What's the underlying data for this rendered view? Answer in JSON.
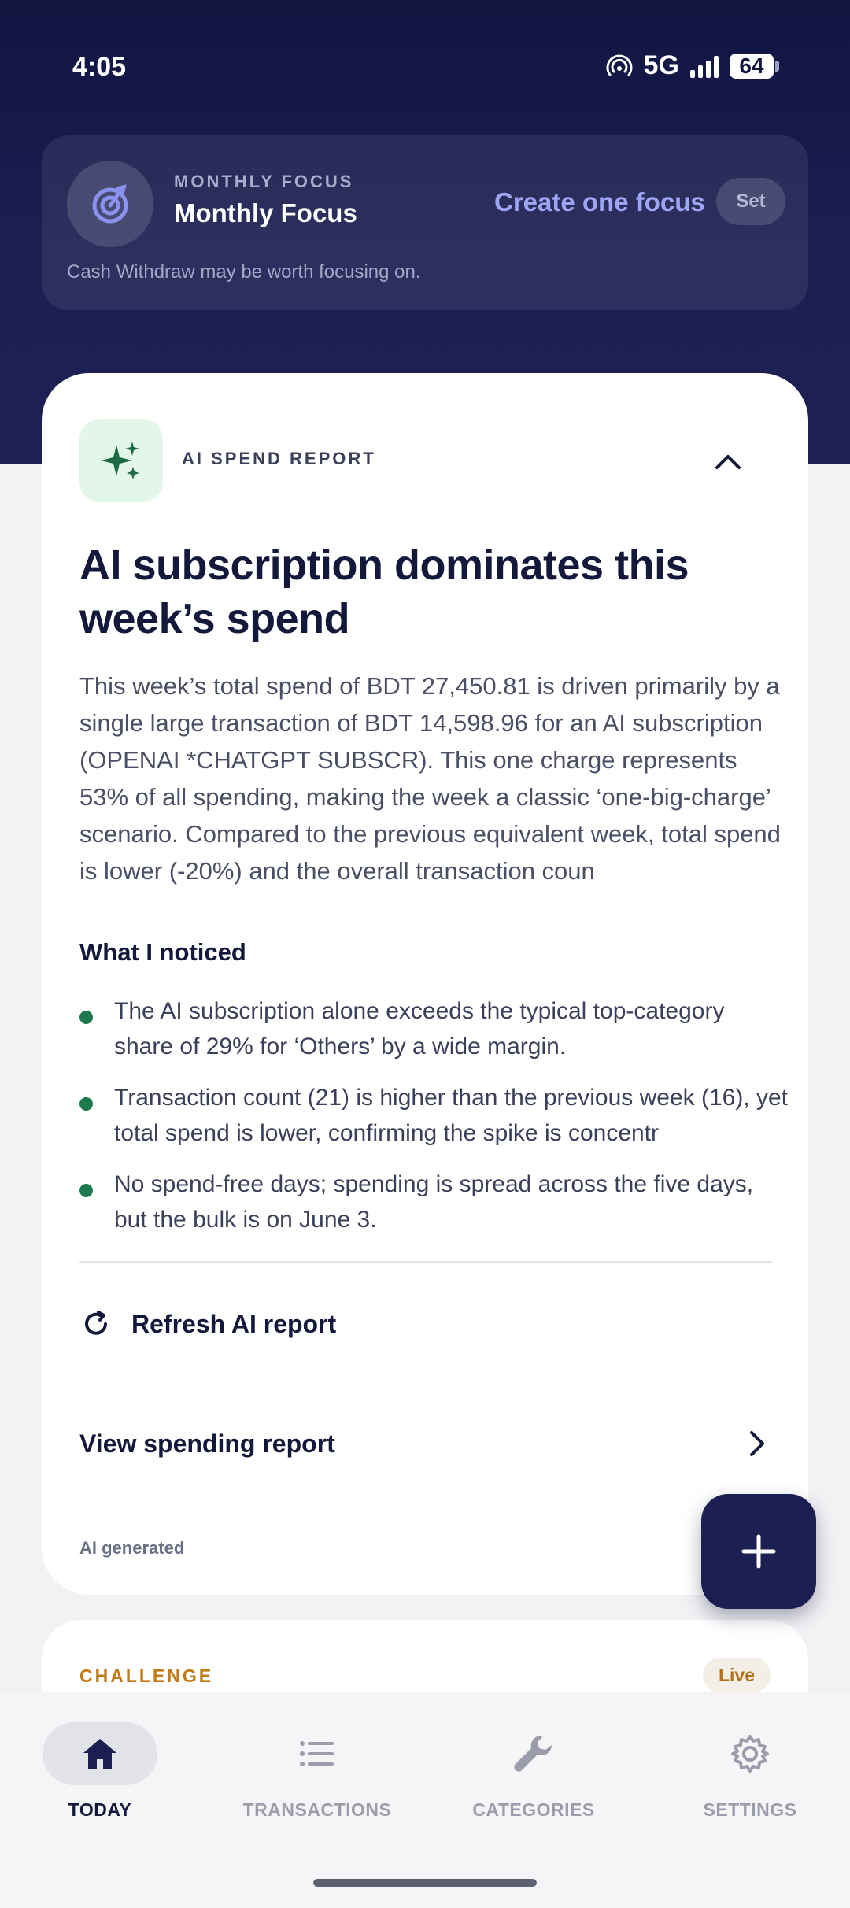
{
  "status_bar": {
    "time": "4:05",
    "network": "5G",
    "battery": "64"
  },
  "focus": {
    "eyebrow": "MONTHLY FOCUS",
    "title": "Monthly Focus",
    "create_label": "Create one focus",
    "set_label": "Set",
    "subtitle": "Cash Withdraw may be worth focusing on."
  },
  "report": {
    "eyebrow": "AI SPEND REPORT",
    "title": "AI subscription dominates this week’s spend",
    "body": "This week’s total spend of BDT 27,450.81 is driven primarily by a single large transaction of BDT 14,598.96 for an AI subscription (OPENAI *CHATGPT SUBSCR). This one charge represents 53% of all spending, making the week a classic ‘one-big-charge’ scenario. Compared to the previous equivalent week, total spend is lower (-20%) and the overall transaction coun",
    "noticed_title": "What I noticed",
    "noticed": [
      "The AI subscription alone exceeds the typical top-category share of 29% for ‘Others’ by a wide margin.",
      "Transaction count (21) is higher than the previous week (16), yet total spend is lower, confirming the spike is concentr",
      "No spend-free days; spending is spread across the five days, but the bulk is on June 3."
    ],
    "refresh_label": "Refresh AI report",
    "view_label": "View spending report",
    "footer": "AI generated"
  },
  "challenge": {
    "label": "CHALLENGE",
    "badge": "Live"
  },
  "nav": {
    "items": [
      {
        "label": "TODAY",
        "icon": "home-icon"
      },
      {
        "label": "TRANSACTIONS",
        "icon": "list-icon"
      },
      {
        "label": "CATEGORIES",
        "icon": "wrench-icon"
      },
      {
        "label": "SETTINGS",
        "icon": "gear-icon"
      }
    ]
  },
  "colors": {
    "header_bg": "#111540",
    "accent_green": "#1d7a4e",
    "focus_link": "#9ea5f2",
    "challenge_orange": "#c07a16"
  }
}
